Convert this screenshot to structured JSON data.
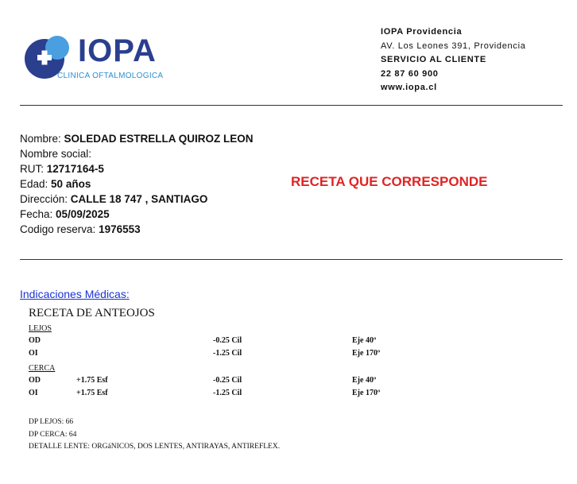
{
  "header": {
    "logo_text": "IOPA",
    "logo_sub_1": "CLINICA",
    "logo_sub_2": "OFTALMOLOGICA",
    "brand_colors": {
      "navy": "#2b3f8f",
      "light_blue": "#2a8fd6"
    },
    "clinic_name": "IOPA Providencia",
    "address": "AV. Los Leones 391, Providencia",
    "service_label": "SERVICIO AL CLIENTE",
    "phone": "22 87 60 900",
    "website": "www.iopa.cl"
  },
  "patient": {
    "name_label": "Nombre:",
    "name": "SOLEDAD ESTRELLA QUIROZ LEON",
    "social_label": "Nombre social:",
    "rut_label": "RUT:",
    "rut": "12717164-5",
    "age_label": "Edad:",
    "age": "50 años",
    "address_label": "Dirección:",
    "address": "CALLE 18 747 , SANTIAGO",
    "date_label": "Fecha:",
    "date": "05/09/2025",
    "booking_label": "Codigo reserva:",
    "booking": "1976553"
  },
  "stamp": {
    "text": "RECETA QUE CORRESPONDE",
    "color": "#e02424"
  },
  "indications_label": "Indicaciones Médicas:",
  "prescription": {
    "title": "RECETA DE ANTEOJOS",
    "far_label": "LEJOS",
    "far": [
      {
        "eye": "OD",
        "sph": "",
        "cyl": "-0.25 Cil",
        "axis": "Eje 40º"
      },
      {
        "eye": "OI",
        "sph": "",
        "cyl": "-1.25 Cil",
        "axis": "Eje 170º"
      }
    ],
    "near_label": "CERCA",
    "near": [
      {
        "eye": "OD",
        "sph": "+1.75 Esf",
        "cyl": "-0.25 Cil",
        "axis": "Eje 40º"
      },
      {
        "eye": "OI",
        "sph": "+1.75 Esf",
        "cyl": "-1.25 Cil",
        "axis": "Eje 170º"
      }
    ],
    "dp_far": "DP LEJOS: 66",
    "dp_near": "DP CERCA: 64",
    "lens_detail": "DETALLE LENTE: ORGáNICOS, DOS LENTES, ANTIRAYAS, ANTIREFLEX."
  }
}
